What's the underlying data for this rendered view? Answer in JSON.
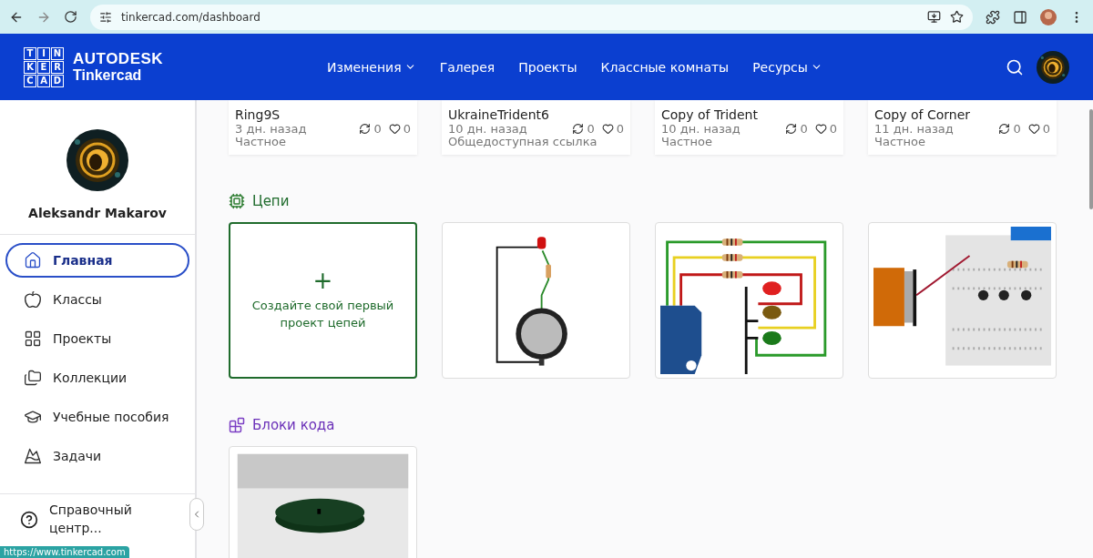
{
  "browser": {
    "url": "tinkercad.com/dashboard",
    "status_url": "https://www.tinkercad.com"
  },
  "brand": {
    "logo_letters": [
      "T",
      "I",
      "N",
      "K",
      "E",
      "R",
      "C",
      "A",
      "D"
    ],
    "company": "AUTODESK",
    "product": "Tinkercad"
  },
  "nav": [
    {
      "label": "Изменения",
      "dropdown": true
    },
    {
      "label": "Галерея",
      "dropdown": false
    },
    {
      "label": "Проекты",
      "dropdown": false
    },
    {
      "label": "Классные комнаты",
      "dropdown": false
    },
    {
      "label": "Ресурсы",
      "dropdown": true
    }
  ],
  "user": {
    "name": "Aleksandr Makarov"
  },
  "sidebar": {
    "items": [
      {
        "label": "Главная",
        "selected": true
      },
      {
        "label": "Классы",
        "selected": false
      },
      {
        "label": "Проекты",
        "selected": false
      },
      {
        "label": "Коллекции",
        "selected": false
      },
      {
        "label": "Учебные пособия",
        "selected": false
      },
      {
        "label": "Задачи",
        "selected": false
      }
    ],
    "help": "Справочный центр..."
  },
  "designs": [
    {
      "name": "Ring9S",
      "time": "3 дн. назад",
      "visibility": "Частное",
      "remixes": "0",
      "likes": "0"
    },
    {
      "name": "UkraineTrident6",
      "time": "10 дн. назад",
      "visibility": "Общедоступная ссылка",
      "remixes": "0",
      "likes": "0"
    },
    {
      "name": "Copy of Trident",
      "time": "10 дн. назад",
      "visibility": "Частное",
      "remixes": "0",
      "likes": "0"
    },
    {
      "name": "Copy of Corner",
      "time": "11 дн. назад",
      "visibility": "Частное",
      "remixes": "0",
      "likes": "0"
    }
  ],
  "sections": [
    {
      "kind": "circuits",
      "title": "Цепи",
      "create": {
        "plus": "+",
        "label": "Создайте свой первый проект цепей"
      },
      "thumbnails": [
        {
          "kind": "battery"
        },
        {
          "kind": "arduino"
        },
        {
          "kind": "breadboard"
        }
      ]
    },
    {
      "kind": "codeblocks",
      "title": "Блоки кода",
      "thumbnails": [
        {
          "kind": "disc"
        }
      ]
    }
  ]
}
